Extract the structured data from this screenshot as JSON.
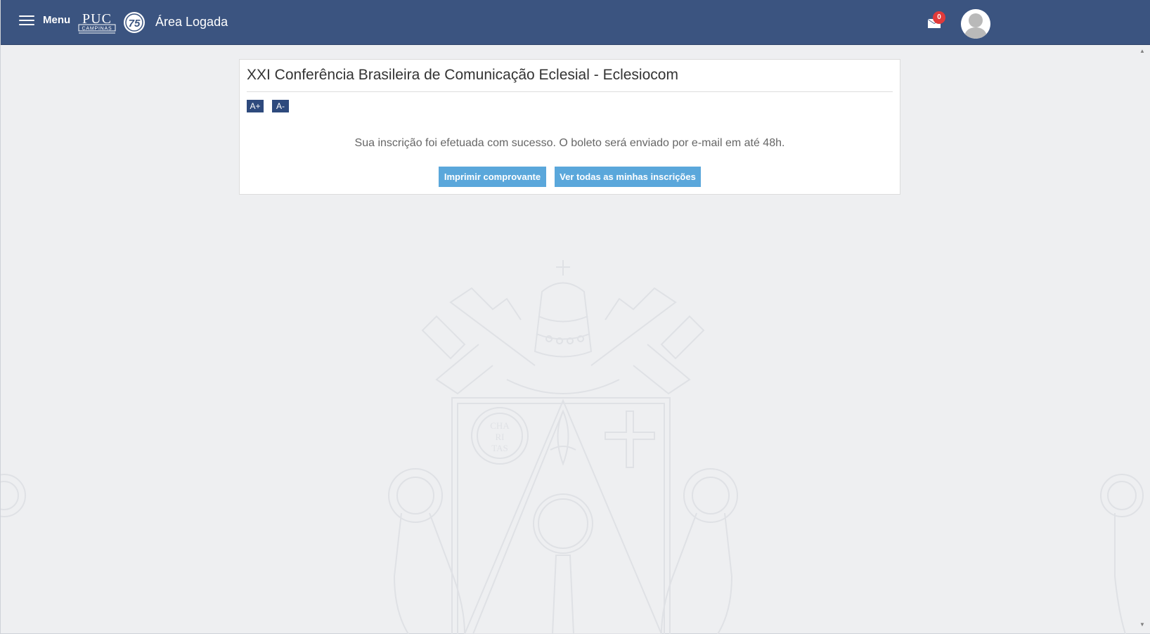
{
  "header": {
    "menu_label": "Menu",
    "logo_text": "PUC",
    "logo_subtext": "CAMPINAS",
    "anniversary_badge": "75",
    "area_title": "Área Logada",
    "notifications_count": "0",
    "bar_color": "#3b5480"
  },
  "card": {
    "title": "XXI Conferência Brasileira de Comunicação Eclesial - Eclesiocom",
    "font_increase_label": "A+",
    "font_decrease_label": "A-",
    "message": "Sua inscrição foi efetuada com sucesso. O boleto será enviado por e-mail em até 48h.",
    "print_button_label": "Imprimir comprovante",
    "all_registrations_button_label": "Ver todas as minhas inscrições",
    "button_color": "#5aa7db",
    "font_button_color": "#2e4a7d"
  },
  "background": {
    "crest_text": [
      "CHA",
      "RI",
      "TAS"
    ]
  }
}
